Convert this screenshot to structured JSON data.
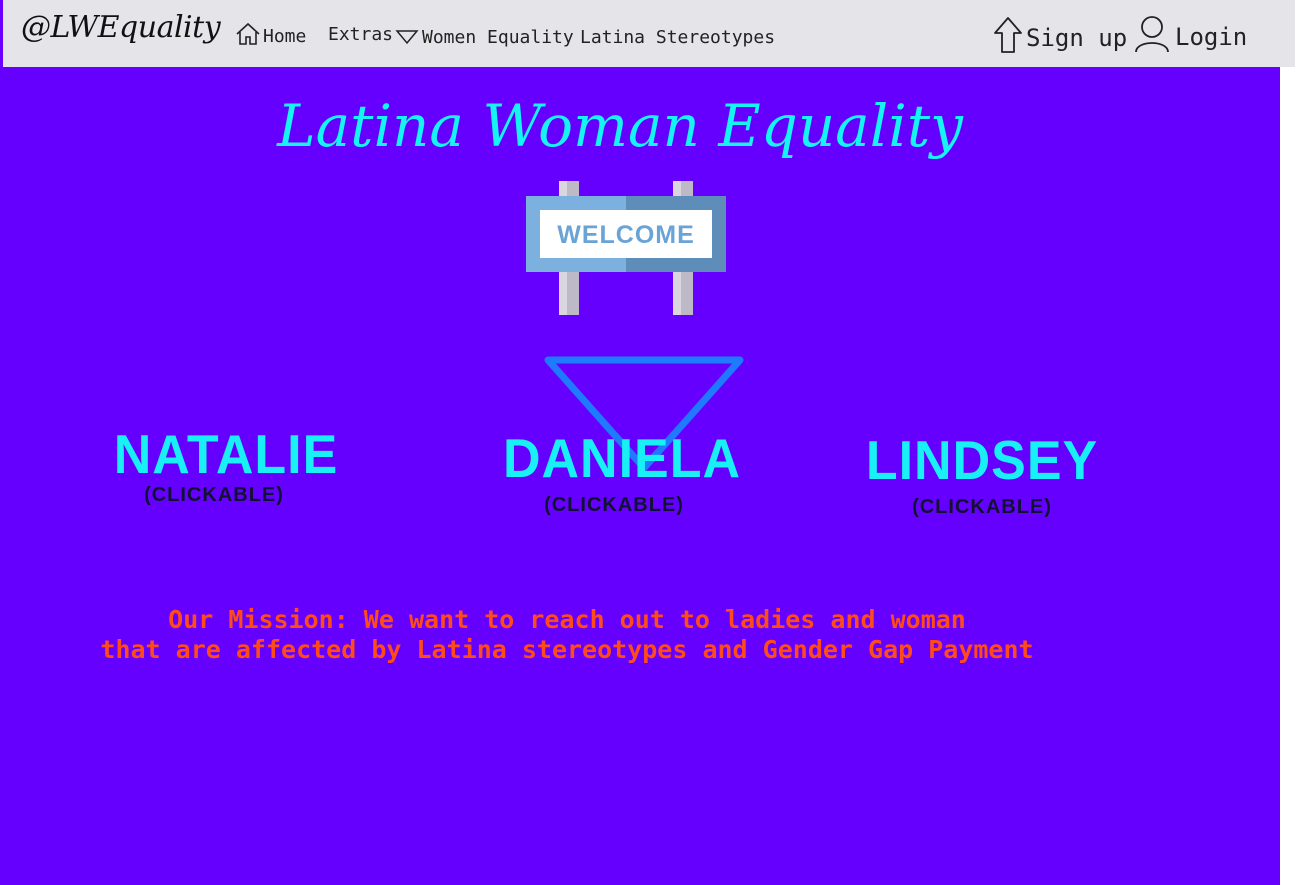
{
  "nav": {
    "brand": "@LWEquality",
    "links": [
      {
        "label": "Home",
        "icon": "home-icon"
      },
      {
        "label": "Extras",
        "icon": "triangle-down-icon"
      },
      {
        "label": "Women Equality"
      },
      {
        "label": "Latina Stereotypes"
      }
    ],
    "signup_label": "Sign up",
    "login_label": "Login"
  },
  "main": {
    "title": "Latina Woman Equality",
    "welcome_sign_text": "WELCOME",
    "people": [
      {
        "name": "NATALIE",
        "sub": "(CLICKABLE)"
      },
      {
        "name": "DANIELA",
        "sub": "(CLICKABLE)"
      },
      {
        "name": "LINDSEY",
        "sub": "(CLICKABLE)"
      }
    ],
    "mission_line1": "Our Mission: We want to reach out to ladies and woman",
    "mission_line2": "that are affected by Latina stereotypes and Gender Gap Payment"
  },
  "colors": {
    "background": "#6500ff",
    "navbar": "#e5e4e8",
    "title": "#16f3f3",
    "name": "#18f0f5",
    "mission": "#ff4a1a",
    "triangle": "#1e7bff"
  }
}
